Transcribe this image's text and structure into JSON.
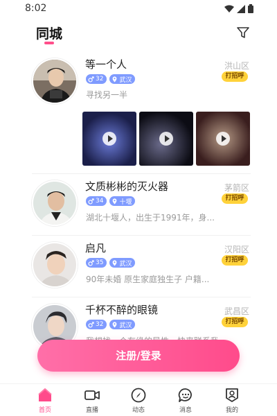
{
  "status_bar": {
    "time": "8:02"
  },
  "header": {
    "title": "同城"
  },
  "users": [
    {
      "name": "等一个人",
      "age": "32",
      "city": "武汉",
      "district": "洪山区",
      "greet": "打招呼",
      "bio": "寻找另一半"
    },
    {
      "name": "文质彬彬的灭火器",
      "age": "34",
      "city": "十堰",
      "district": "茅箭区",
      "greet": "打招呼",
      "bio": "湖北十堰人，出生于1991年，身..."
    },
    {
      "name": "启凡",
      "age": "35",
      "city": "武汉",
      "district": "汉阳区",
      "greet": "打招呼",
      "bio": "90年未婚 原生家庭独生子 户籍..."
    },
    {
      "name": "千杯不醉的眼镜",
      "age": "32",
      "city": "武汉",
      "district": "武昌区",
      "greet": "打招呼",
      "bio": "我想找一个有缘的异性，快来联系我"
    }
  ],
  "register_button": "注册/登录",
  "tabbar": [
    {
      "label": "首页",
      "icon": "home-icon"
    },
    {
      "label": "直播",
      "icon": "video-camera-icon"
    },
    {
      "label": "动态",
      "icon": "compass-icon"
    },
    {
      "label": "消息",
      "icon": "chat-bubble-icon"
    },
    {
      "label": "我的",
      "icon": "profile-icon"
    }
  ],
  "colors": {
    "accent": "#ff4b8b",
    "tag_blue": "#7f9bff",
    "greet_yellow": "#ffd23a"
  }
}
